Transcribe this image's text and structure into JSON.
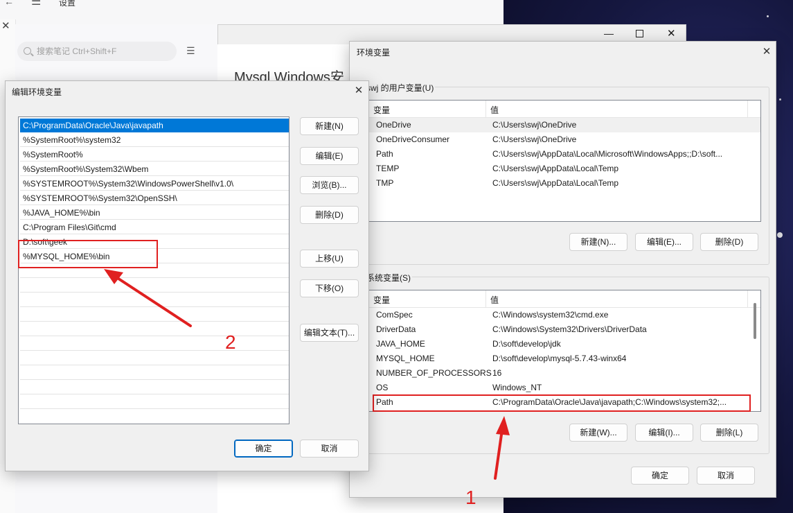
{
  "notes_app": {
    "settings_title": "设置",
    "search_placeholder": "搜索笔记 Ctrl+Shift+F",
    "doc_title": "Mysql Windows安"
  },
  "env_window": {
    "title": "环境变量",
    "user_group_label": "swj 的用户变量(U)",
    "user_columns": [
      "变量",
      "值"
    ],
    "user_vars": [
      {
        "name": "OneDrive",
        "value": "C:\\Users\\swj\\OneDrive"
      },
      {
        "name": "OneDriveConsumer",
        "value": "C:\\Users\\swj\\OneDrive"
      },
      {
        "name": "Path",
        "value": "C:\\Users\\swj\\AppData\\Local\\Microsoft\\WindowsApps;;D:\\soft..."
      },
      {
        "name": "TEMP",
        "value": "C:\\Users\\swj\\AppData\\Local\\Temp"
      },
      {
        "name": "TMP",
        "value": "C:\\Users\\swj\\AppData\\Local\\Temp"
      }
    ],
    "user_buttons": {
      "new": "新建(N)...",
      "edit": "编辑(E)...",
      "delete": "删除(D)"
    },
    "system_group_label": "系统变量(S)",
    "system_columns": [
      "变量",
      "值"
    ],
    "system_vars": [
      {
        "name": "ComSpec",
        "value": "C:\\Windows\\system32\\cmd.exe"
      },
      {
        "name": "DriverData",
        "value": "C:\\Windows\\System32\\Drivers\\DriverData"
      },
      {
        "name": "JAVA_HOME",
        "value": "D:\\soft\\develop\\jdk"
      },
      {
        "name": "MYSQL_HOME",
        "value": "D:\\soft\\develop\\mysql-5.7.43-winx64"
      },
      {
        "name": "NUMBER_OF_PROCESSORS",
        "value": "16"
      },
      {
        "name": "OS",
        "value": "Windows_NT"
      },
      {
        "name": "Path",
        "value": "C:\\ProgramData\\Oracle\\Java\\javapath;C:\\Windows\\system32;..."
      }
    ],
    "system_buttons": {
      "new": "新建(W)...",
      "edit": "编辑(I)...",
      "delete": "删除(L)"
    },
    "ok": "确定",
    "cancel": "取消"
  },
  "edit_window": {
    "title": "编辑环境变量",
    "entries": [
      "C:\\ProgramData\\Oracle\\Java\\javapath",
      "%SystemRoot%\\system32",
      "%SystemRoot%",
      "%SystemRoot%\\System32\\Wbem",
      "%SYSTEMROOT%\\System32\\WindowsPowerShell\\v1.0\\",
      "%SYSTEMROOT%\\System32\\OpenSSH\\",
      "%JAVA_HOME%\\bin",
      "C:\\Program Files\\Git\\cmd",
      "D:\\soft\\geek",
      "%MYSQL_HOME%\\bin"
    ],
    "buttons": {
      "new": "新建(N)",
      "edit": "编辑(E)",
      "browse": "浏览(B)...",
      "delete": "删除(D)",
      "up": "上移(U)",
      "down": "下移(O)",
      "edit_text": "编辑文本(T)..."
    },
    "ok": "确定",
    "cancel": "取消"
  },
  "annotations": {
    "label_1": "1",
    "label_2": "2",
    "color": "#e02020"
  },
  "colors": {
    "selection": "#0078d7",
    "accent": "#0067c0"
  }
}
